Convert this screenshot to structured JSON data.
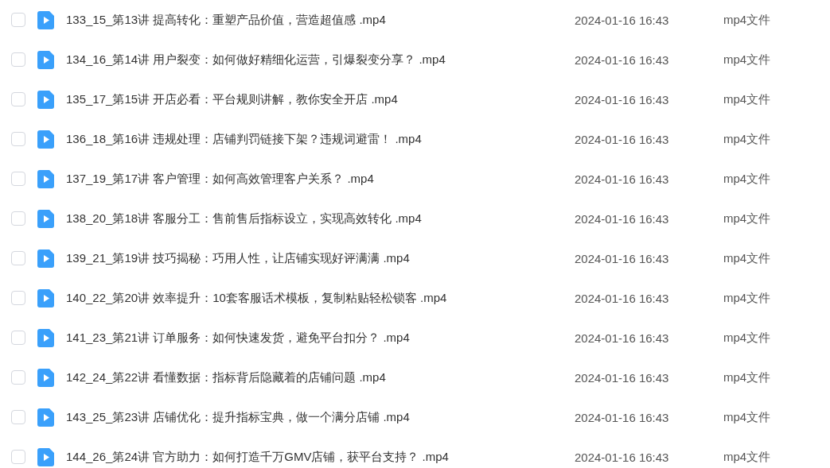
{
  "files": [
    {
      "name": "133_15_第13讲 提高转化：重塑产品价值，营造超值感 .mp4",
      "date": "2024-01-16 16:43",
      "type": "mp4文件",
      "checked": false
    },
    {
      "name": "134_16_第14讲 用户裂变：如何做好精细化运营，引爆裂变分享？ .mp4",
      "date": "2024-01-16 16:43",
      "type": "mp4文件",
      "checked": false
    },
    {
      "name": "135_17_第15讲 开店必看：平台规则讲解，教你安全开店 .mp4",
      "date": "2024-01-16 16:43",
      "type": "mp4文件",
      "checked": false
    },
    {
      "name": "136_18_第16讲 违规处理：店铺判罚链接下架？违规词避雷！ .mp4",
      "date": "2024-01-16 16:43",
      "type": "mp4文件",
      "checked": false
    },
    {
      "name": "137_19_第17讲 客户管理：如何高效管理客户关系？ .mp4",
      "date": "2024-01-16 16:43",
      "type": "mp4文件",
      "checked": false
    },
    {
      "name": "138_20_第18讲 客服分工：售前售后指标设立，实现高效转化 .mp4",
      "date": "2024-01-16 16:43",
      "type": "mp4文件",
      "checked": false
    },
    {
      "name": "139_21_第19讲 技巧揭秘：巧用人性，让店铺实现好评满满 .mp4",
      "date": "2024-01-16 16:43",
      "type": "mp4文件",
      "checked": false
    },
    {
      "name": "140_22_第20讲 效率提升：10套客服话术模板，复制粘贴轻松锁客 .mp4",
      "date": "2024-01-16 16:43",
      "type": "mp4文件",
      "checked": false
    },
    {
      "name": "141_23_第21讲 订单服务：如何快速发货，避免平台扣分？ .mp4",
      "date": "2024-01-16 16:43",
      "type": "mp4文件",
      "checked": false
    },
    {
      "name": "142_24_第22讲 看懂数据：指标背后隐藏着的店铺问题 .mp4",
      "date": "2024-01-16 16:43",
      "type": "mp4文件",
      "checked": false
    },
    {
      "name": "143_25_第23讲 店铺优化：提升指标宝典，做一个满分店铺 .mp4",
      "date": "2024-01-16 16:43",
      "type": "mp4文件",
      "checked": false
    },
    {
      "name": "144_26_第24讲 官方助力：如何打造千万GMV店铺，获平台支持？ .mp4",
      "date": "2024-01-16 16:43",
      "type": "mp4文件",
      "checked": false
    }
  ]
}
